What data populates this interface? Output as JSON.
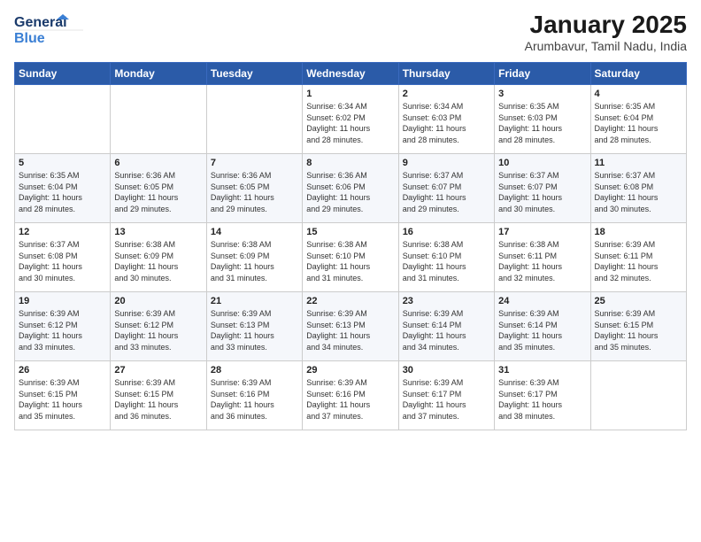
{
  "header": {
    "logo_general": "General",
    "logo_blue": "Blue",
    "title": "January 2025",
    "subtitle": "Arumbavur, Tamil Nadu, India"
  },
  "days_of_week": [
    "Sunday",
    "Monday",
    "Tuesday",
    "Wednesday",
    "Thursday",
    "Friday",
    "Saturday"
  ],
  "weeks": [
    [
      {
        "day": "",
        "info": ""
      },
      {
        "day": "",
        "info": ""
      },
      {
        "day": "",
        "info": ""
      },
      {
        "day": "1",
        "info": "Sunrise: 6:34 AM\nSunset: 6:02 PM\nDaylight: 11 hours\nand 28 minutes."
      },
      {
        "day": "2",
        "info": "Sunrise: 6:34 AM\nSunset: 6:03 PM\nDaylight: 11 hours\nand 28 minutes."
      },
      {
        "day": "3",
        "info": "Sunrise: 6:35 AM\nSunset: 6:03 PM\nDaylight: 11 hours\nand 28 minutes."
      },
      {
        "day": "4",
        "info": "Sunrise: 6:35 AM\nSunset: 6:04 PM\nDaylight: 11 hours\nand 28 minutes."
      }
    ],
    [
      {
        "day": "5",
        "info": "Sunrise: 6:35 AM\nSunset: 6:04 PM\nDaylight: 11 hours\nand 28 minutes."
      },
      {
        "day": "6",
        "info": "Sunrise: 6:36 AM\nSunset: 6:05 PM\nDaylight: 11 hours\nand 29 minutes."
      },
      {
        "day": "7",
        "info": "Sunrise: 6:36 AM\nSunset: 6:05 PM\nDaylight: 11 hours\nand 29 minutes."
      },
      {
        "day": "8",
        "info": "Sunrise: 6:36 AM\nSunset: 6:06 PM\nDaylight: 11 hours\nand 29 minutes."
      },
      {
        "day": "9",
        "info": "Sunrise: 6:37 AM\nSunset: 6:07 PM\nDaylight: 11 hours\nand 29 minutes."
      },
      {
        "day": "10",
        "info": "Sunrise: 6:37 AM\nSunset: 6:07 PM\nDaylight: 11 hours\nand 30 minutes."
      },
      {
        "day": "11",
        "info": "Sunrise: 6:37 AM\nSunset: 6:08 PM\nDaylight: 11 hours\nand 30 minutes."
      }
    ],
    [
      {
        "day": "12",
        "info": "Sunrise: 6:37 AM\nSunset: 6:08 PM\nDaylight: 11 hours\nand 30 minutes."
      },
      {
        "day": "13",
        "info": "Sunrise: 6:38 AM\nSunset: 6:09 PM\nDaylight: 11 hours\nand 30 minutes."
      },
      {
        "day": "14",
        "info": "Sunrise: 6:38 AM\nSunset: 6:09 PM\nDaylight: 11 hours\nand 31 minutes."
      },
      {
        "day": "15",
        "info": "Sunrise: 6:38 AM\nSunset: 6:10 PM\nDaylight: 11 hours\nand 31 minutes."
      },
      {
        "day": "16",
        "info": "Sunrise: 6:38 AM\nSunset: 6:10 PM\nDaylight: 11 hours\nand 31 minutes."
      },
      {
        "day": "17",
        "info": "Sunrise: 6:38 AM\nSunset: 6:11 PM\nDaylight: 11 hours\nand 32 minutes."
      },
      {
        "day": "18",
        "info": "Sunrise: 6:39 AM\nSunset: 6:11 PM\nDaylight: 11 hours\nand 32 minutes."
      }
    ],
    [
      {
        "day": "19",
        "info": "Sunrise: 6:39 AM\nSunset: 6:12 PM\nDaylight: 11 hours\nand 33 minutes."
      },
      {
        "day": "20",
        "info": "Sunrise: 6:39 AM\nSunset: 6:12 PM\nDaylight: 11 hours\nand 33 minutes."
      },
      {
        "day": "21",
        "info": "Sunrise: 6:39 AM\nSunset: 6:13 PM\nDaylight: 11 hours\nand 33 minutes."
      },
      {
        "day": "22",
        "info": "Sunrise: 6:39 AM\nSunset: 6:13 PM\nDaylight: 11 hours\nand 34 minutes."
      },
      {
        "day": "23",
        "info": "Sunrise: 6:39 AM\nSunset: 6:14 PM\nDaylight: 11 hours\nand 34 minutes."
      },
      {
        "day": "24",
        "info": "Sunrise: 6:39 AM\nSunset: 6:14 PM\nDaylight: 11 hours\nand 35 minutes."
      },
      {
        "day": "25",
        "info": "Sunrise: 6:39 AM\nSunset: 6:15 PM\nDaylight: 11 hours\nand 35 minutes."
      }
    ],
    [
      {
        "day": "26",
        "info": "Sunrise: 6:39 AM\nSunset: 6:15 PM\nDaylight: 11 hours\nand 35 minutes."
      },
      {
        "day": "27",
        "info": "Sunrise: 6:39 AM\nSunset: 6:15 PM\nDaylight: 11 hours\nand 36 minutes."
      },
      {
        "day": "28",
        "info": "Sunrise: 6:39 AM\nSunset: 6:16 PM\nDaylight: 11 hours\nand 36 minutes."
      },
      {
        "day": "29",
        "info": "Sunrise: 6:39 AM\nSunset: 6:16 PM\nDaylight: 11 hours\nand 37 minutes."
      },
      {
        "day": "30",
        "info": "Sunrise: 6:39 AM\nSunset: 6:17 PM\nDaylight: 11 hours\nand 37 minutes."
      },
      {
        "day": "31",
        "info": "Sunrise: 6:39 AM\nSunset: 6:17 PM\nDaylight: 11 hours\nand 38 minutes."
      },
      {
        "day": "",
        "info": ""
      }
    ]
  ]
}
